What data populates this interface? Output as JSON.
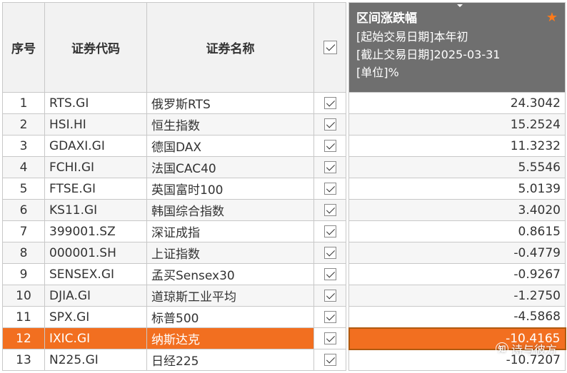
{
  "headers": {
    "seq": "序号",
    "code": "证券代码",
    "name": "证券名称",
    "metric": {
      "title": "区间涨跌幅",
      "line1": "[起始交易日期]本年初",
      "line2": "[截止交易日期]2025-03-31",
      "line3": "[单位]%"
    }
  },
  "rows": [
    {
      "no": "1",
      "code": "RTS.GI",
      "name": "俄罗斯RTS",
      "value": "24.3042"
    },
    {
      "no": "2",
      "code": "HSI.HI",
      "name": "恒生指数",
      "value": "15.2524"
    },
    {
      "no": "3",
      "code": "GDAXI.GI",
      "name": "德国DAX",
      "value": "11.3232"
    },
    {
      "no": "4",
      "code": "FCHI.GI",
      "name": "法国CAC40",
      "value": "5.5546"
    },
    {
      "no": "5",
      "code": "FTSE.GI",
      "name": "英国富时100",
      "value": "5.0139"
    },
    {
      "no": "6",
      "code": "KS11.GI",
      "name": "韩国综合指数",
      "value": "3.4020"
    },
    {
      "no": "7",
      "code": "399001.SZ",
      "name": "深证成指",
      "value": "0.8615"
    },
    {
      "no": "8",
      "code": "000001.SH",
      "name": "上证指数",
      "value": "-0.4779"
    },
    {
      "no": "9",
      "code": "SENSEX.GI",
      "name": "孟买Sensex30",
      "value": "-0.9267"
    },
    {
      "no": "10",
      "code": "DJIA.GI",
      "name": "道琼斯工业平均",
      "value": "-1.2750"
    },
    {
      "no": "11",
      "code": "SPX.GI",
      "name": "标普500",
      "value": "-4.5868"
    },
    {
      "no": "12",
      "code": "IXIC.GI",
      "name": "纳斯达克",
      "value": "-10.4165"
    },
    {
      "no": "13",
      "code": "N225.GI",
      "name": "日经225",
      "value": "-10.7207"
    }
  ],
  "selected_row": 12,
  "colors": {
    "selected": "#f26f20",
    "metric_header": "#6f6f6f",
    "star": "#ff7a1a"
  },
  "icons": {
    "star": "star-icon",
    "checkbox": "checkbox-icon",
    "sort": "sort-caret-icon"
  },
  "watermark": {
    "text": "诗与彼方",
    "logo": "知"
  }
}
